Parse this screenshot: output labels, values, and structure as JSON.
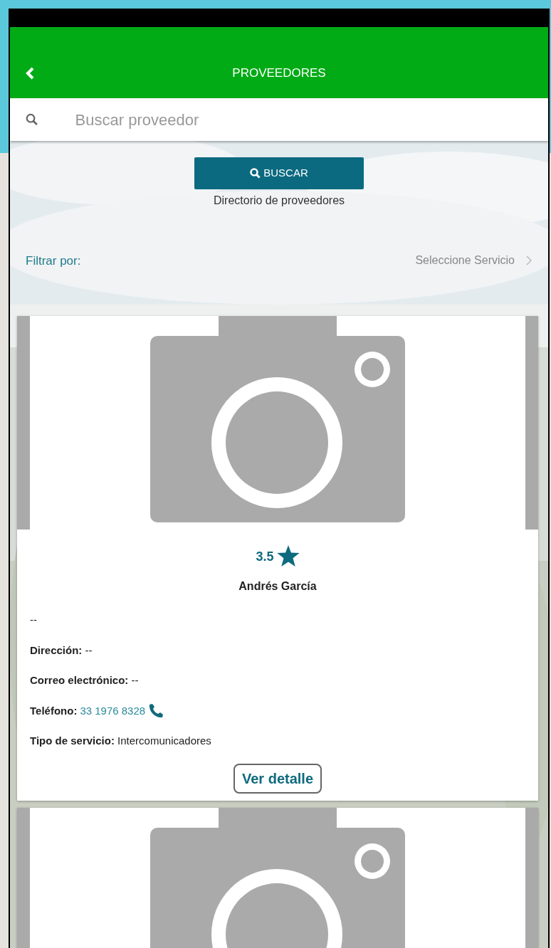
{
  "header": {
    "title": "PROVEEDORES"
  },
  "search": {
    "placeholder": "Buscar proveedor"
  },
  "search_button": {
    "label": "BUSCAR"
  },
  "subtitle": "Directorio de proveedores",
  "filter": {
    "label": "Filtrar por:",
    "value": "Seleccione Servicio"
  },
  "providers": [
    {
      "kind": "full",
      "rating": "3.5",
      "name": "Andrés García",
      "fields": [
        {
          "kind": "plain",
          "value": "--"
        },
        {
          "kind": "text",
          "label": "Dirección:",
          "value": "--"
        },
        {
          "kind": "text",
          "label": "Correo electrónico:",
          "value": "--"
        },
        {
          "kind": "phone",
          "label": "Teléfono:",
          "value": "33 1976 8328"
        },
        {
          "kind": "text",
          "label": "Tipo de servicio:",
          "value": "Intercomunicadores"
        }
      ],
      "button": "Ver detalle"
    },
    {
      "kind": "cut"
    }
  ]
}
